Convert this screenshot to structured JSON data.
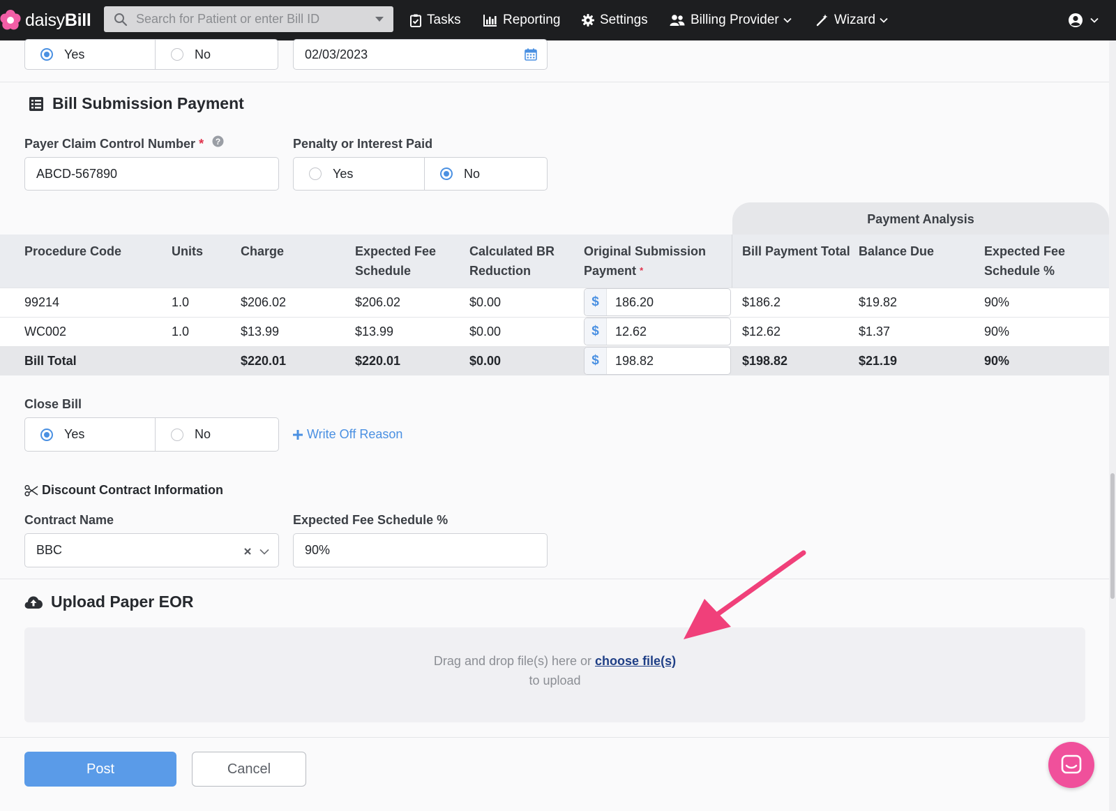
{
  "nav": {
    "logo_prefix": "daisy",
    "logo_suffix": "Bill",
    "search_placeholder": "Search for Patient or enter Bill ID",
    "tasks": "Tasks",
    "reporting": "Reporting",
    "settings": "Settings",
    "billing_provider": "Billing Provider",
    "wizard": "Wizard"
  },
  "top_fields": {
    "radio_yes": "Yes",
    "radio_no": "No",
    "radio_selected": "Yes",
    "date": "02/03/2023"
  },
  "bill_submission": {
    "title": "Bill Submission Payment",
    "payer_claim_label": "Payer Claim Control Number",
    "payer_claim_required": "*",
    "payer_claim_value": "ABCD-567890",
    "penalty_label": "Penalty or Interest Paid",
    "penalty_yes": "Yes",
    "penalty_no": "No",
    "penalty_selected": "No"
  },
  "table": {
    "payment_analysis_label": "Payment Analysis",
    "headers": {
      "procedure_code": "Procedure Code",
      "units": "Units",
      "charge": "Charge",
      "expected_fee_1": "Expected Fee",
      "expected_fee_2": "Schedule",
      "calc_br_1": "Calculated BR",
      "calc_br_2": "Reduction",
      "orig_sub_1": "Original Submission",
      "orig_sub_2": "Payment",
      "orig_sub_required": "*",
      "bill_payment_total": "Bill Payment Total",
      "balance_due": "Balance Due",
      "expected_pct_1": "Expected Fee",
      "expected_pct_2": "Schedule %"
    },
    "currency_symbol": "$",
    "rows": [
      {
        "code": "99214",
        "units": "1.0",
        "charge": "$206.02",
        "expected": "$206.02",
        "br": "$0.00",
        "payment": "186.20",
        "total": "$186.2",
        "balance": "$19.82",
        "pct": "90%"
      },
      {
        "code": "WC002",
        "units": "1.0",
        "charge": "$13.99",
        "expected": "$13.99",
        "br": "$0.00",
        "payment": "12.62",
        "total": "$12.62",
        "balance": "$1.37",
        "pct": "90%"
      }
    ],
    "total_row": {
      "label": "Bill Total",
      "charge": "$220.01",
      "expected": "$220.01",
      "br": "$0.00",
      "payment": "198.82",
      "total": "$198.82",
      "balance": "$21.19",
      "pct": "90%"
    }
  },
  "close_bill": {
    "label": "Close Bill",
    "yes": "Yes",
    "no": "No",
    "selected": "Yes",
    "write_off_link": "Write Off Reason"
  },
  "discount_contract": {
    "title": "Discount Contract Information",
    "contract_name_label": "Contract Name",
    "contract_name_value": "BBC",
    "expected_fee_pct_label": "Expected Fee Schedule %",
    "expected_fee_pct_value": "90%"
  },
  "upload": {
    "title": "Upload Paper EOR",
    "text_before": "Drag and drop file(s) here or",
    "link": "choose file(s)",
    "text_after": "to upload"
  },
  "actions": {
    "post": "Post",
    "cancel": "Cancel"
  },
  "colors": {
    "accent": "#4a90e2",
    "annotation_arrow": "#f0407a",
    "chat_button": "#f0509b",
    "required": "#e0334c"
  }
}
